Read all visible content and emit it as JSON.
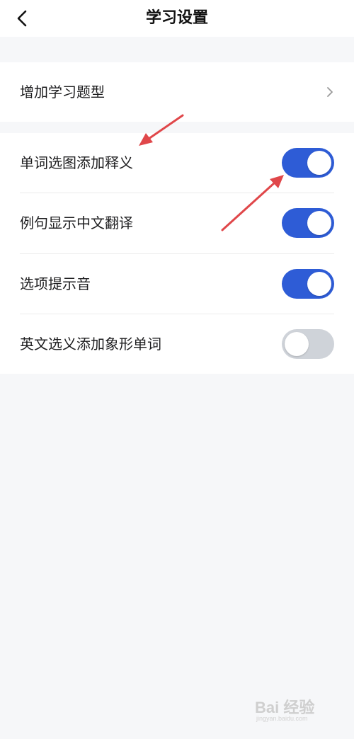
{
  "header": {
    "title": "学习设置",
    "back_icon": "chevron-left-icon"
  },
  "sections": [
    {
      "items": [
        {
          "label": "增加学习题型",
          "type": "nav",
          "icon": "chevron-right-icon"
        }
      ]
    },
    {
      "items": [
        {
          "label": "单词选图添加释义",
          "type": "toggle",
          "on": true
        },
        {
          "label": "例句显示中文翻译",
          "type": "toggle",
          "on": true
        },
        {
          "label": "选项提示音",
          "type": "toggle",
          "on": true
        },
        {
          "label": "英文选义添加象形单词",
          "type": "toggle",
          "on": false
        }
      ]
    }
  ],
  "watermark": {
    "text": "Bai 经验",
    "sub": "jingyan.baidu.com"
  },
  "colors": {
    "toggle_on": "#2e5cd6",
    "toggle_off": "#cfd3d9",
    "annotation_arrow": "#e0474a",
    "background": "#f6f7f9"
  }
}
